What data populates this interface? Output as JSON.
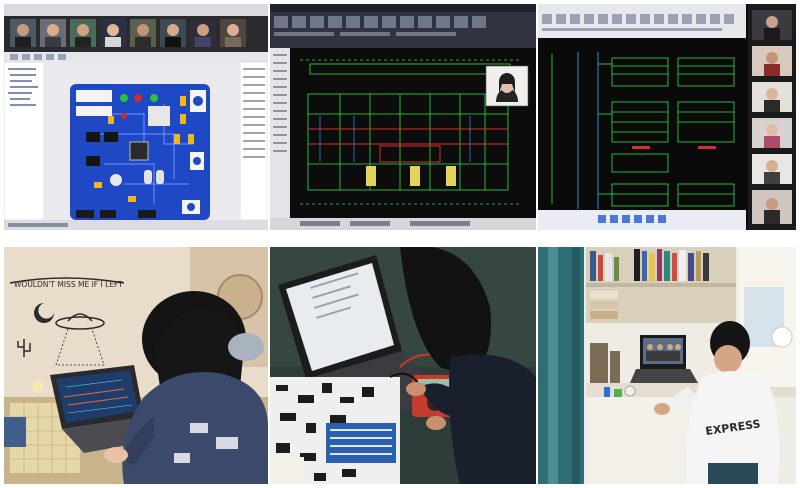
{
  "collage": {
    "panels": [
      {
        "id": "pcb-design-screen",
        "kind": "screenshot",
        "description_icon": "pcb-board-icon"
      },
      {
        "id": "cad-floorplan-screen",
        "kind": "screenshot",
        "description_icon": "blueprint-icon"
      },
      {
        "id": "schematic-screen",
        "kind": "screenshot",
        "description_icon": "schematic-icon"
      },
      {
        "id": "student-laptop-photo",
        "kind": "photo",
        "description_icon": "laptop-icon"
      },
      {
        "id": "multimeter-photo",
        "kind": "photo",
        "description_icon": "multimeter-icon"
      },
      {
        "id": "dorm-desk-photo",
        "kind": "photo",
        "description_icon": "desk-icon"
      }
    ],
    "wall_text": "WOULDN'T MISS ME IF I LEFT",
    "shirt_text": "EXPRESS"
  },
  "colors": {
    "pcb_blue": "#1f49c4",
    "cad_bg": "#0c0c0c",
    "cad_green": "#2ee04a",
    "cad_red": "#d23030",
    "ui_gray": "#e9e9ee",
    "wall_beige": "#e9dccb"
  }
}
